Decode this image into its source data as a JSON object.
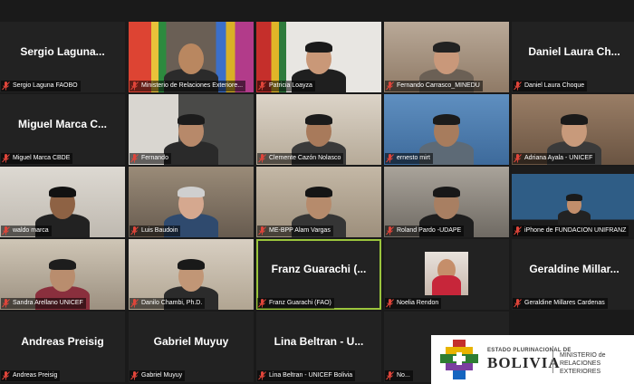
{
  "participants": [
    {
      "name": "Sergio Laguna FAOBO",
      "display": "Sergio Laguna...",
      "video": false
    },
    {
      "name": "Ministerio de Relaciones Exteriore...",
      "video": true,
      "scene": "flags"
    },
    {
      "name": "Patricia Loayza",
      "video": true,
      "scene": "woman-flag"
    },
    {
      "name": "Fernando Carrasco_MINEDU",
      "video": true,
      "scene": "man-glasses"
    },
    {
      "name": "Daniel Laura Choque",
      "display": "Daniel Laura Ch...",
      "video": false
    },
    {
      "name": "Miguel Marca CBDE",
      "display": "Miguel Marca C...",
      "video": false
    },
    {
      "name": "Fernando",
      "video": true,
      "scene": "man-office"
    },
    {
      "name": "Clemente Cazón Nolasco",
      "video": true,
      "scene": "man-glasses2"
    },
    {
      "name": "ernesto mirt",
      "video": true,
      "scene": "man-blue"
    },
    {
      "name": "Adriana Ayala - UNICEF",
      "video": true,
      "scene": "woman"
    },
    {
      "name": "waldo marca",
      "video": true,
      "scene": "man-board"
    },
    {
      "name": "Luis Baudoin",
      "video": true,
      "scene": "old-man"
    },
    {
      "name": "ME-BPP Alam Vargas",
      "video": true,
      "scene": "man-thinking"
    },
    {
      "name": "Roland Pardo -UDAPE",
      "video": true,
      "scene": "man-desk"
    },
    {
      "name": "iPhone de FUNDACION UNIFRANZ",
      "video": true,
      "scene": "woman-phone"
    },
    {
      "name": "Sandra Arellano UNICEF",
      "video": true,
      "scene": "woman-room"
    },
    {
      "name": "Danilo Chambi, Ph.D.",
      "video": true,
      "scene": "man-glasses3"
    },
    {
      "name": "Franz Guarachi (FAO)",
      "display": "Franz Guarachi (...",
      "video": false,
      "active": true
    },
    {
      "name": "Noelia Rendon",
      "video": false,
      "avatar": true
    },
    {
      "name": "Geraldine Millares Cardenas",
      "display": "Geraldine Millar...",
      "video": false
    },
    {
      "name": "Andreas Preisig",
      "display": "Andreas Preisig",
      "video": false
    },
    {
      "name": "Gabriel Muyuy",
      "display": "Gabriel Muyuy",
      "video": false
    },
    {
      "name": "Lina Beltran - UNICEF Bolivia",
      "display": "Lina Beltran - U...",
      "video": false
    },
    {
      "name": "No...",
      "display": "No...",
      "video": false
    }
  ],
  "watermark": {
    "estado": "ESTADO PLURINACIONAL DE",
    "country": "BOLIVIA",
    "ministry_line1": "MINISTERIO de",
    "ministry_line2": "RELACIONES EXTERIORES"
  },
  "colors": {
    "background": "#1a1a1a",
    "tile": "#222222",
    "active_border": "#9bc53d",
    "muted_mic": "#e0453a"
  }
}
